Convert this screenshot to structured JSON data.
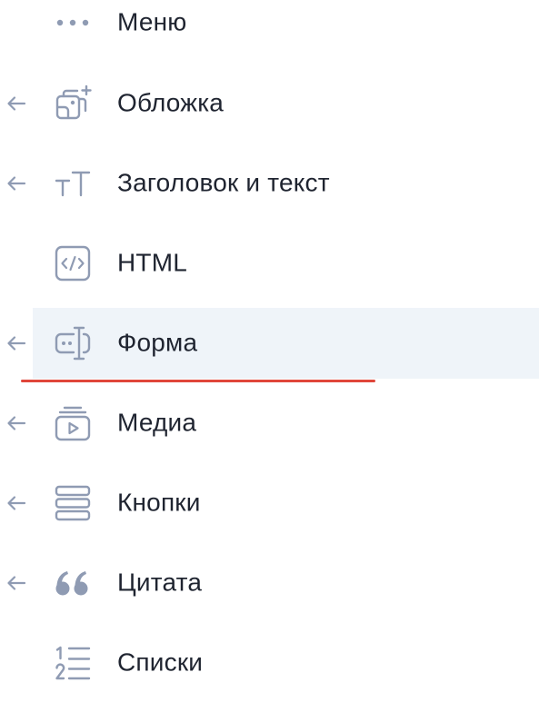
{
  "menu": {
    "items": [
      {
        "label": "Меню",
        "icon": "dots-icon",
        "has_arrow": false
      },
      {
        "label": "Обложка",
        "icon": "cover-icon",
        "has_arrow": true
      },
      {
        "label": "Заголовок и текст",
        "icon": "text-size-icon",
        "has_arrow": true
      },
      {
        "label": "HTML",
        "icon": "code-icon",
        "has_arrow": false
      },
      {
        "label": "Форма",
        "icon": "form-field-icon",
        "has_arrow": true,
        "active": true
      },
      {
        "label": "Медиа",
        "icon": "media-icon",
        "has_arrow": true
      },
      {
        "label": "Кнопки",
        "icon": "buttons-icon",
        "has_arrow": true
      },
      {
        "label": "Цитата",
        "icon": "quote-icon",
        "has_arrow": true
      },
      {
        "label": "Списки",
        "icon": "numbered-list-icon",
        "has_arrow": false
      }
    ]
  },
  "colors": {
    "icon": "#8f9bb3",
    "text": "#1f2430",
    "active_bg": "#eff4f9",
    "underline": "#e0463a"
  }
}
